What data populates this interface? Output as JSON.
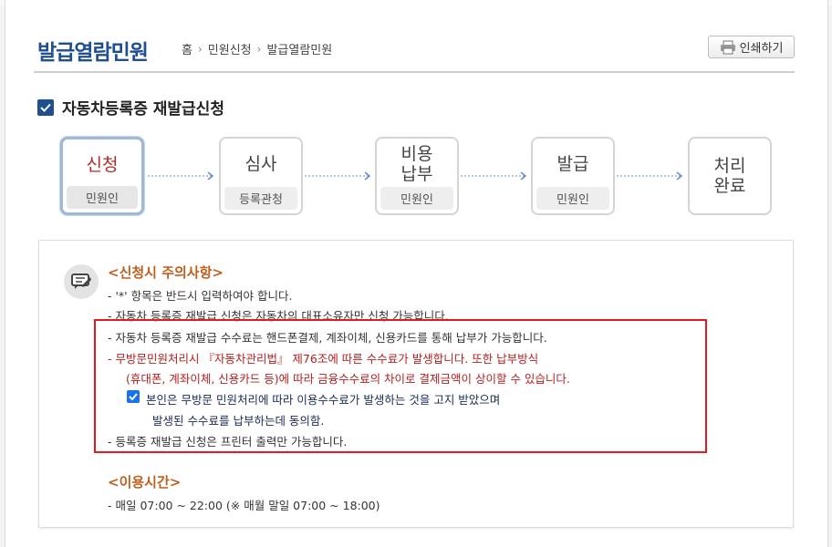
{
  "header": {
    "title": "발급열람민원",
    "breadcrumb": [
      "홈",
      "민원신청",
      "발급열람민원"
    ],
    "print_label": "인쇄하기"
  },
  "section": {
    "title": "자동차등록증 재발급신청",
    "icon": "checkbox-checked-icon",
    "accent": "#1f4f91"
  },
  "steps": [
    {
      "name": "신청",
      "role": "민원인",
      "active": true
    },
    {
      "name": "심사",
      "role": "등록관청",
      "active": false
    },
    {
      "name": "비용\n납부",
      "role": "민원인",
      "active": false
    },
    {
      "name": "발급",
      "role": "민원인",
      "active": false
    },
    {
      "name": "처리\n완료",
      "role": "",
      "active": false
    }
  ],
  "notice": {
    "heading": "<신청시 주의사항>",
    "lines": [
      "- '*' 항목은 반드시 입력하여야 합니다.",
      "- 자동차 등록증 재발급 신청은 자동차의 대표소유자만 신청 가능합니다.",
      "- 자동차 등록증 재발급 수수료는 핸드폰결제, 계좌이체, 신용카드를 통해 납부가 가능합니다.",
      "- 무방문민원처리시 『자동차관리법』 제76조에 따른 수수료가 발생합니다. 또한 납부방식",
      "(휴대폰, 계좌이체, 신용카드 등)에 따라 금융수수료의 차이로 결제금액이 상이할 수 있습니다.",
      "본인은 무방문 민원처리에 따라 이용수수료가 발생하는 것을 고지 받았으며",
      "발생된 수수료를 납부하는데 동의함.",
      "- 등록증 재발급 신청은 프린터 출력만 가능합니다."
    ],
    "consent_checked": true,
    "highlight_color": "#e01b24",
    "usage_heading": "<이용시간>",
    "usage_line": "- 매일 07:00 ~ 22:00 (※ 매월 말일 07:00 ~ 18:00)"
  }
}
